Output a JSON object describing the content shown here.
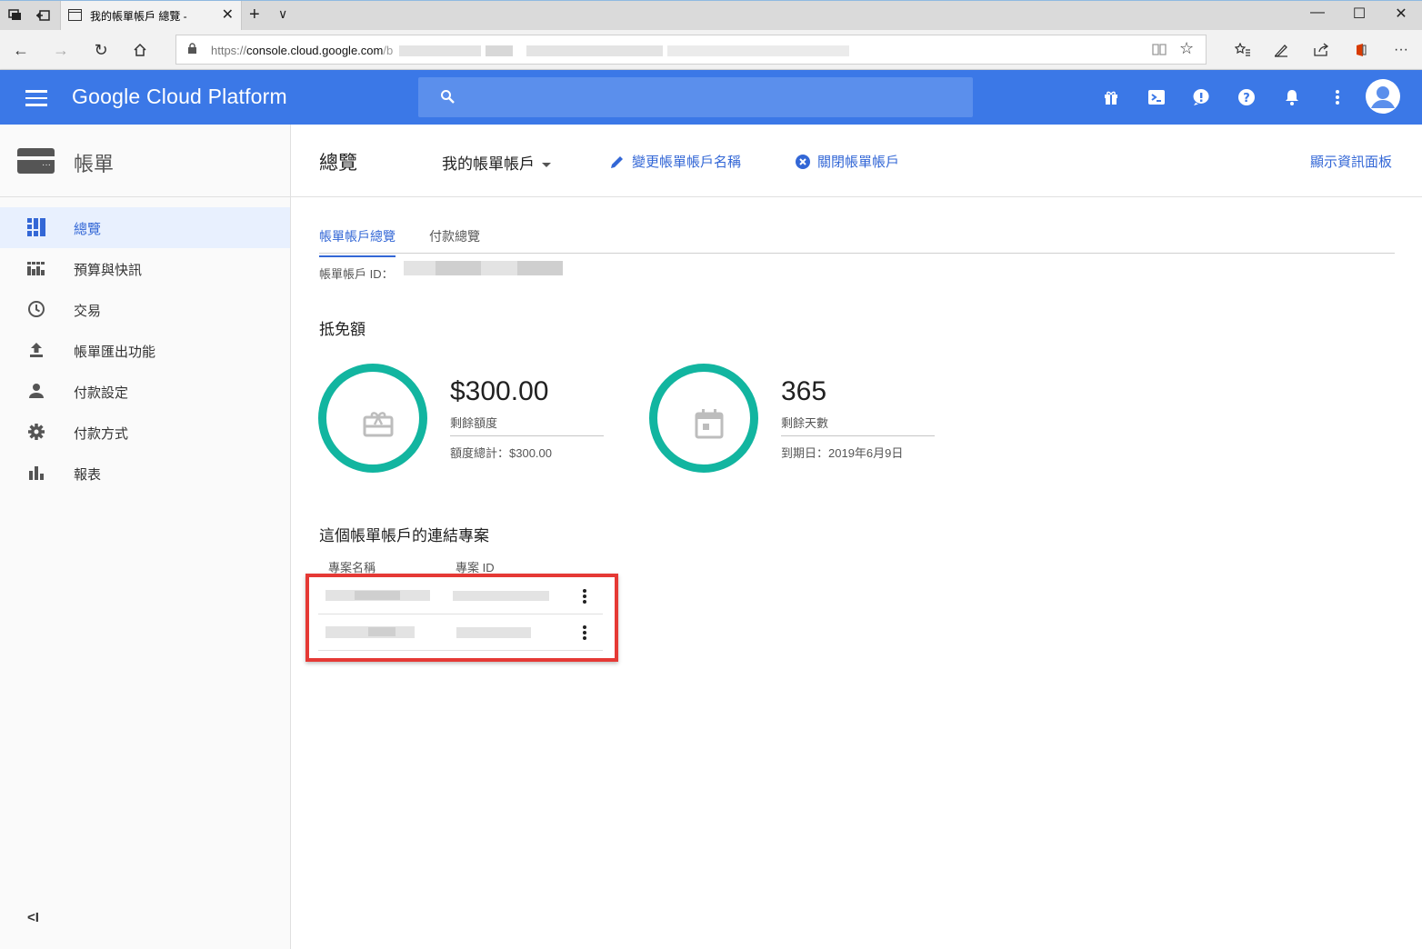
{
  "browser": {
    "tab_title": "我的帳單帳戶 總覽 -",
    "url_prefix": "https://",
    "url_host": "console.cloud.google.com",
    "url_rest": "/b"
  },
  "header": {
    "brand": "Google Cloud Platform",
    "search_placeholder": ""
  },
  "sidebar": {
    "title": "帳單",
    "items": [
      {
        "label": "總覽",
        "icon": "dashboard-icon",
        "active": true
      },
      {
        "label": "預算與快訊",
        "icon": "budget-icon",
        "active": false
      },
      {
        "label": "交易",
        "icon": "clock-icon",
        "active": false
      },
      {
        "label": "帳單匯出功能",
        "icon": "upload-icon",
        "active": false
      },
      {
        "label": "付款設定",
        "icon": "person-icon",
        "active": false
      },
      {
        "label": "付款方式",
        "icon": "gear-icon",
        "active": false
      },
      {
        "label": "報表",
        "icon": "bar-chart-icon",
        "active": false
      }
    ],
    "collapse_label": "<I"
  },
  "toolbar": {
    "title": "總覽",
    "account": "我的帳單帳戶",
    "rename": "變更帳單帳戶名稱",
    "close": "關閉帳單帳戶",
    "dashboard": "顯示資訊面板"
  },
  "tabs": [
    {
      "label": "帳單帳戶總覽",
      "active": true
    },
    {
      "label": "付款總覽",
      "active": false
    }
  ],
  "account_id_label": "帳單帳戶 ID：",
  "credits": {
    "title": "抵免額",
    "amount": {
      "value": "$300.00",
      "label": "剩餘額度",
      "sub": "額度總計：$300.00"
    },
    "days": {
      "value": "365",
      "label": "剩餘天數",
      "sub": "到期日：2019年6月9日"
    }
  },
  "projects": {
    "title": "這個帳單帳戶的連結專案",
    "col_name": "專案名稱",
    "col_id": "專案 ID"
  },
  "colors": {
    "header": "#3b78e7",
    "accent": "#3367d6",
    "ring": "#12b5a0",
    "highlight": "#e53935"
  }
}
